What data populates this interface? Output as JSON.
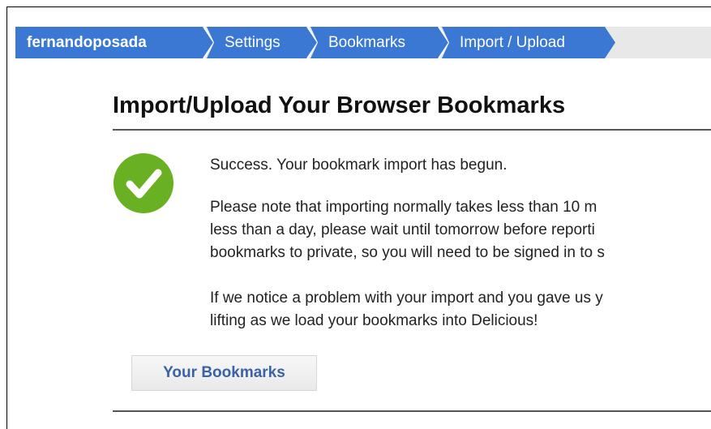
{
  "breadcrumb": {
    "items": [
      {
        "label": "fernandoposada"
      },
      {
        "label": "Settings"
      },
      {
        "label": "Bookmarks"
      },
      {
        "label": "Import / Upload"
      }
    ],
    "color": "#3a78d4",
    "bar_background": "#e8e8e8"
  },
  "page": {
    "title": "Import/Upload Your Browser Bookmarks"
  },
  "status": {
    "icon": "success-check-icon",
    "icon_color": "#6ab023",
    "success_line": "Success. Your bookmark import has begun.",
    "note_lines": [
      "Please note that importing normally takes less than 10 m",
      "less than a day, please wait until tomorrow before reporti",
      "bookmarks to private, so you will need to be signed in to s"
    ],
    "problem_lines": [
      "If we notice a problem with your import and you gave us y",
      "lifting as we load your bookmarks into Delicious!"
    ]
  },
  "actions": {
    "your_bookmarks_label": "Your Bookmarks"
  }
}
